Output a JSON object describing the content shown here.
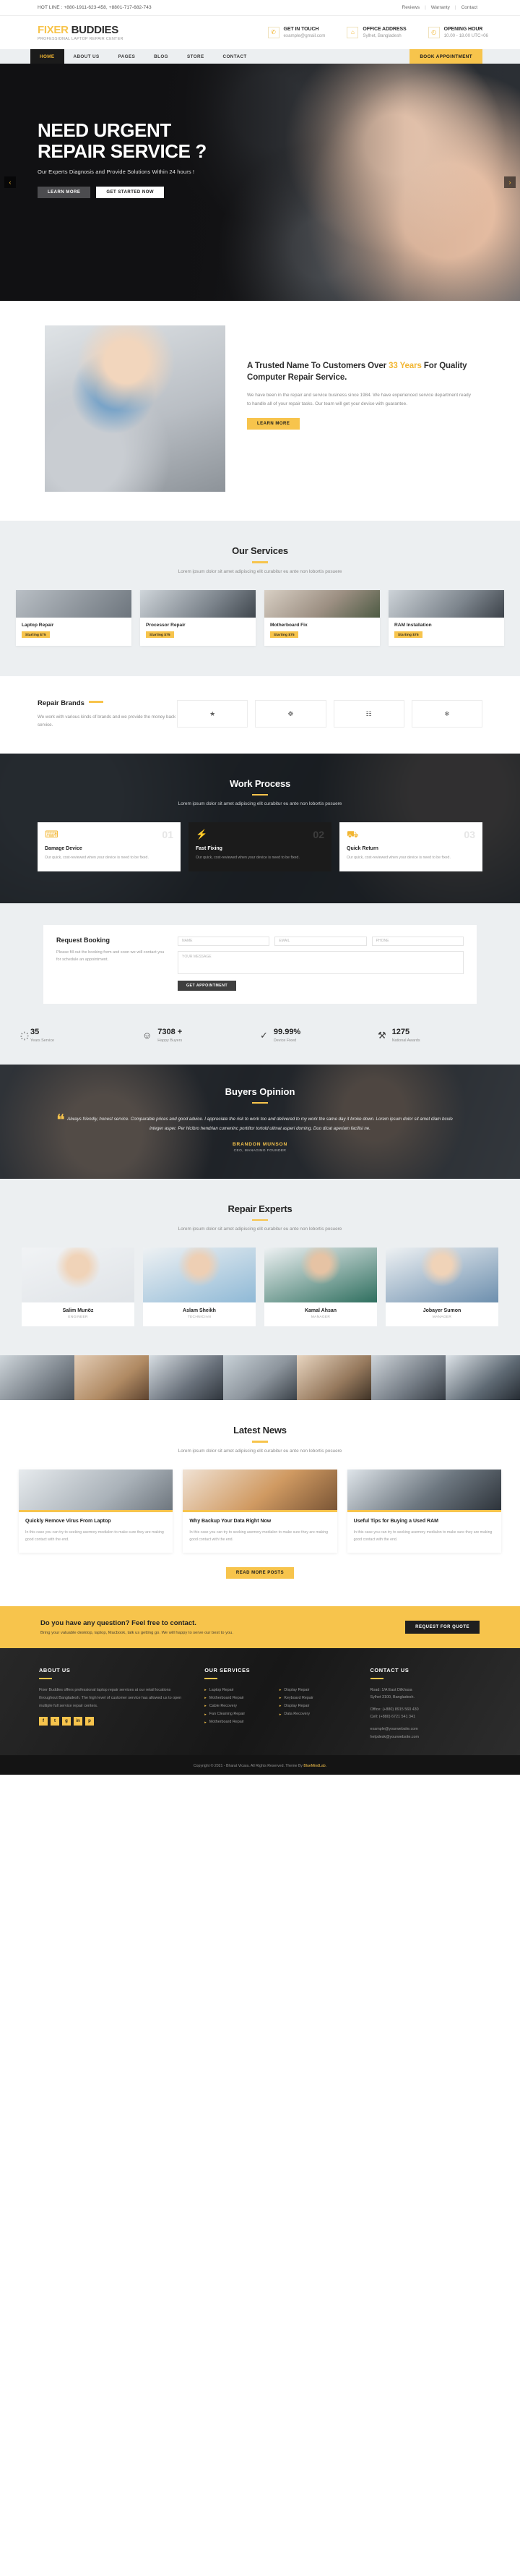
{
  "topbar": {
    "hotline": "HOT LINE : +880-1911-623-458, +8801-717-682-743",
    "links": [
      "Reviews",
      "Warranty",
      "Contact"
    ]
  },
  "header": {
    "logo_first": "FIXER",
    "logo_second": "BUDDIES",
    "logo_tagline": "PROFESSIONAL LAPTOP REPAIR CENTER",
    "infos": [
      {
        "icon": "phone-icon",
        "glyph": "✆",
        "title": "GET IN TOUCH",
        "sub": "example@gmail.com"
      },
      {
        "icon": "home-icon",
        "glyph": "⌂",
        "title": "OFFICE ADDRESS",
        "sub": "Sylhet, Bangladesh"
      },
      {
        "icon": "clock-icon",
        "glyph": "◴",
        "title": "OPENING HOUR",
        "sub": "10.00 - 18.00 UTC+06"
      }
    ]
  },
  "nav": {
    "items": [
      "HOME",
      "ABOUT US",
      "PAGES",
      "BLOG",
      "STORE",
      "CONTACT"
    ],
    "active": "HOME",
    "cta": "BOOK APPOINTMENT"
  },
  "hero": {
    "title_line1": "NEED URGENT",
    "title_line2": "REPAIR SERVICE ?",
    "subtitle": "Our Experts Diagnosis and Provide Solutions Within 24 hours !",
    "btn_primary": "LEARN MORE",
    "btn_secondary": "GET STARTED NOW",
    "prev": "‹",
    "next": "›"
  },
  "about": {
    "heading_pre": "A Trusted Name To Customers Over ",
    "heading_hl": "33 Years",
    "heading_post": " For Quality Computer Repair Service.",
    "paragraph": "We have been in the repair and service business since 1984. We have experienced service department ready to handle all of your repair tasks. Our team will get your device with guarantee.",
    "button": "LEARN MORE"
  },
  "services": {
    "title": "Our Services",
    "subtitle": "Lorem ipsum dolor sit amet adipiscing elit curabitur eu ante non lobortis posuere",
    "items": [
      {
        "name": "Laptop Repair",
        "tag": "Starting $75"
      },
      {
        "name": "Processor Repair",
        "tag": "Starting $75"
      },
      {
        "name": "Motherboard Fix",
        "tag": "Starting $75"
      },
      {
        "name": "RAM Installation",
        "tag": "Starting $75"
      }
    ]
  },
  "brands": {
    "title": "Repair Brands",
    "description": "We work with various kinds of brands and we provide the money back service.",
    "logos": [
      "brand-logo-1",
      "brand-logo-2",
      "brand-logo-3",
      "brand-logo-4"
    ]
  },
  "process": {
    "title": "Work Process",
    "subtitle": "Lorem ipsum dolor sit amet adipiscing elit curabitur eu ante non lobortis posuere",
    "steps": [
      {
        "icon": "laptop-icon",
        "glyph": "⌨",
        "num": "01",
        "title": "Damage Device",
        "desc": "Our quick, cost-reviewed when your device is need to be fixed."
      },
      {
        "icon": "bolt-icon",
        "glyph": "⚡",
        "num": "02",
        "title": "Fast Fixing",
        "desc": "Our quick, cost-reviewed when your device is need to be fixed."
      },
      {
        "icon": "truck-icon",
        "glyph": "⛟",
        "num": "03",
        "title": "Quick Return",
        "desc": "Our quick, cost-reviewed when your device is need to be fixed."
      }
    ]
  },
  "booking": {
    "title": "Request Booking",
    "description": "Please fill out the booking form and soon we will contact you for schedule an appointment.",
    "fields": {
      "name": "NAME",
      "email": "EMAIL",
      "phone": "PHONE",
      "message": "YOUR MESSAGE"
    },
    "submit": "GET APPOINTMENT"
  },
  "counters": [
    {
      "icon": "users-icon",
      "glyph": "҉",
      "number": "35",
      "label": "Years Service"
    },
    {
      "icon": "smile-icon",
      "glyph": "☺",
      "number": "7308 +",
      "label": "Happy Buyers"
    },
    {
      "icon": "check-icon",
      "glyph": "✓",
      "number": "99.99%",
      "label": "Device Fixed"
    },
    {
      "icon": "wrench-icon",
      "glyph": "⚒",
      "number": "1275",
      "label": "National Awards"
    }
  ],
  "testimonial": {
    "title": "Buyers Opinion",
    "quote": "Always friendly, honest service. Comparable prices and good advice. I appreciate the risk to work too and delivered to my work the same day it broke down. Lorem ipsum dolor sit amet diam bcule integer asper. Per hicibro hendrian cumeninc porttitor tortold ullmat asperi doming. Duo dicat aperiam facilisi ne.",
    "name": "BRANDON MUNSON",
    "role": "CEO, MANAGING FOUNDER"
  },
  "team": {
    "title": "Repair Experts",
    "subtitle": "Lorem ipsum dolor sit amet adipiscing elit curabitur eu ante non lobortis posuere",
    "members": [
      {
        "name": "Salim Munöz",
        "role": "ENGINEER"
      },
      {
        "name": "Aslam Sheikh",
        "role": "TECHNICIAN"
      },
      {
        "name": "Kamal Ahsan",
        "role": "MANAGER"
      },
      {
        "name": "Jobayer Sumon",
        "role": "MANAGER"
      }
    ]
  },
  "gallery": [
    "gallery-1",
    "gallery-2",
    "gallery-3",
    "gallery-4",
    "gallery-5",
    "gallery-6",
    "gallery-7"
  ],
  "news": {
    "title": "Latest News",
    "subtitle": "Lorem ipsum dolor sit amet adipiscing elit curabitur eu ante non lobortis posuere",
    "posts": [
      {
        "title": "Quickly Remove Virus From Laptop",
        "desc": "In this case you can try to seeking asemory medialon to make sure they are making good contact with the end."
      },
      {
        "title": "Why Backup Your Data Right Now",
        "desc": "In this case you can try to seeking asemory medialon to make sure they are making good contact with the end."
      },
      {
        "title": "Useful Tips for Buying a Used RAM",
        "desc": "In this case you can try to seeking asemory medialon to make sure they are making good contact with the end."
      }
    ],
    "more_button": "READ MORE POSTS"
  },
  "cta": {
    "heading": "Do you have any question? Feel free to contact.",
    "sub": "Bring your valuable desktop, laptop, Macbook, talk us getting go. We will happy to serve our best to you.",
    "button": "REQUEST FOR QUOTE"
  },
  "footer": {
    "about": {
      "title": "ABOUT US",
      "text": "Fixer Buddies offers professional laptop repair services at our retail locations throughout Bangladesh. The high level of customer service has allowed us to open multiple full service repair centers.",
      "socials": [
        "f",
        "t",
        "g",
        "in",
        "p"
      ]
    },
    "services": {
      "title": "OUR SERVICES",
      "items": [
        "Laptop Repair",
        "Motherboard Repair",
        "Cable Recovery",
        "Display Repair",
        "Keyboard Repair",
        "Display Repair",
        "Fan Cleaning Repair",
        "Motherboard Repair",
        "Data Recovery"
      ]
    },
    "contact": {
      "title": "CONTACT US",
      "lines": [
        "Road: 1/A East Dilkhusa",
        "Sylhet 3100, Bangladesh.",
        "Office: (+880) 8915 560 430",
        "Cell: (+880) 6721 541 341",
        "example@yourwebsite.com",
        "helpdesk@yourwebsite.com"
      ]
    }
  },
  "copyright": {
    "text": "Copyright © 2021 - Bharat Vicara. All Rights Reserved. Theme By ",
    "highlight": "BlueMindLab."
  }
}
